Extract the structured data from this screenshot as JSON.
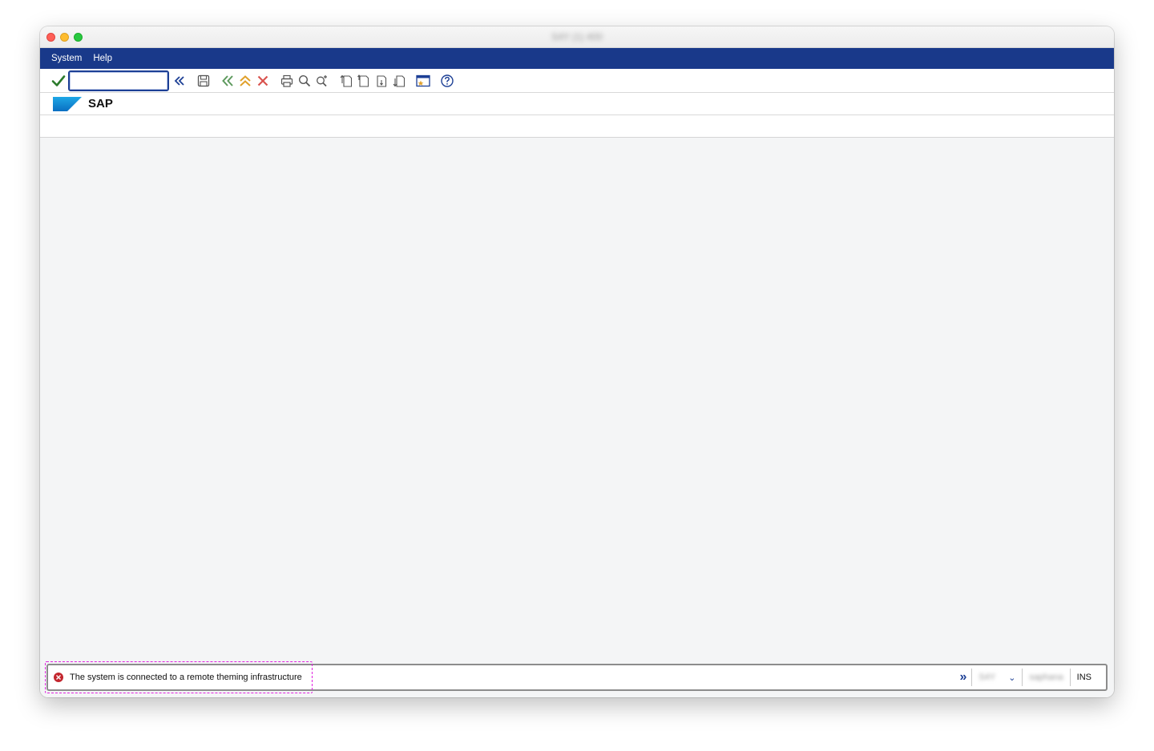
{
  "window": {
    "title": "S4Y (1) 400"
  },
  "menu": {
    "items": [
      "System",
      "Help"
    ]
  },
  "toolbar": {
    "command_field": {
      "value": "",
      "placeholder": ""
    },
    "icons": [
      "enter-check-icon",
      "expand-command-icon",
      "save-icon",
      "back-icon",
      "exit-icon",
      "cancel-icon",
      "print-icon",
      "find-icon",
      "find-next-icon",
      "first-page-icon",
      "previous-page-icon",
      "next-page-icon",
      "last-page-icon",
      "layout-menu-icon",
      "help-icon"
    ]
  },
  "header": {
    "title": "SAP",
    "logo_text": "SAP"
  },
  "status": {
    "message": "The system is connected to a remote theming infrastructure",
    "type": "error",
    "system": "S4Y",
    "server": "saphana",
    "mode": "INS"
  },
  "colors": {
    "menubar": "#19398a",
    "accent": "#1c3f95",
    "error": "#c3262e",
    "highlight": "#e01fe0"
  }
}
